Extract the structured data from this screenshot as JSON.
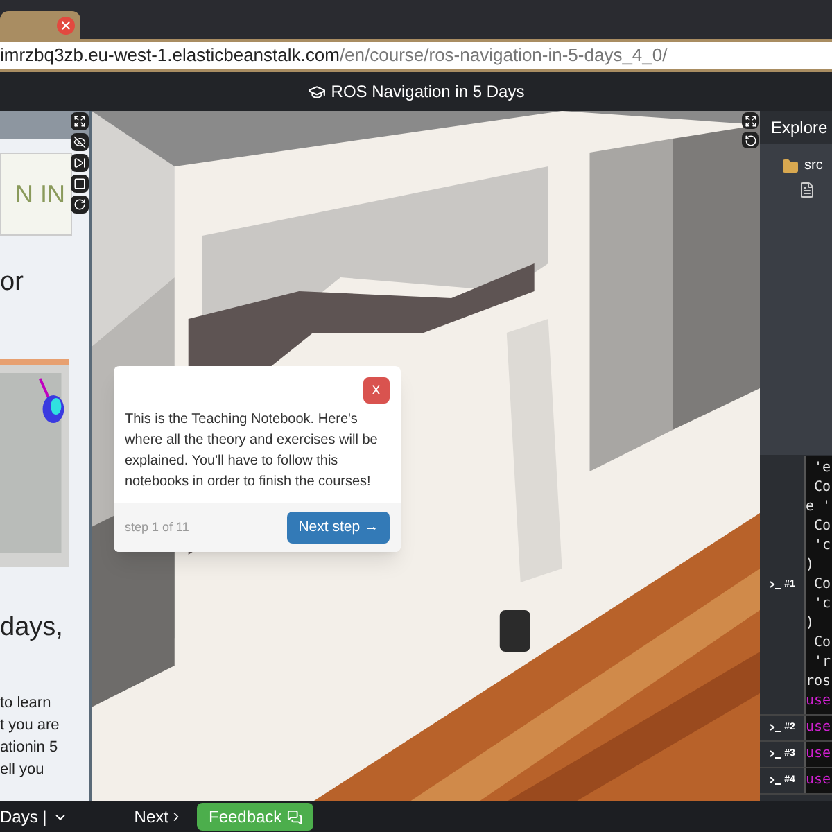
{
  "browser": {
    "url_host": "imrzbq3zb.eu-west-1.elasticbeanstalk.com",
    "url_path": "/en/course/ros-navigation-in-5-days_4_0/"
  },
  "header": {
    "title": "ROS Navigation in 5 Days"
  },
  "notebook": {
    "heading": "N IN",
    "line": "or",
    "subheading": "days,",
    "paragraph_lines": [
      "to learn",
      "t you are",
      "ationin 5",
      "ell you"
    ]
  },
  "tour": {
    "close": "x",
    "text": "This is the Teaching Notebook. Here's where all the theory and exercises will be explained. You'll have to follow this notebooks in order to finish the courses!",
    "step": "step 1 of 11",
    "next": "Next step →"
  },
  "explorer": {
    "title": "Explore",
    "items": [
      {
        "kind": "folder",
        "name": "src"
      },
      {
        "kind": "file"
      }
    ]
  },
  "terminals": [
    {
      "label": "#1",
      "lines": [
        {
          "kind": "output",
          "text": " 'e"
        },
        {
          "kind": "output",
          "text": " Co"
        },
        {
          "kind": "output",
          "text": "e '"
        },
        {
          "kind": "output",
          "text": " Co"
        },
        {
          "kind": "output",
          "text": " 'c"
        },
        {
          "kind": "output",
          "text": ")"
        },
        {
          "kind": "output",
          "text": " Co"
        },
        {
          "kind": "output",
          "text": " 'c"
        },
        {
          "kind": "output",
          "text": ")"
        },
        {
          "kind": "output",
          "text": " Co"
        },
        {
          "kind": "output",
          "text": " 'r"
        },
        {
          "kind": "output",
          "text": "ros"
        },
        {
          "kind": "prompt",
          "text": "use"
        }
      ]
    },
    {
      "label": "#2",
      "lines": [
        {
          "kind": "prompt",
          "text": "use"
        }
      ]
    },
    {
      "label": "#3",
      "lines": [
        {
          "kind": "prompt",
          "text": "use"
        }
      ]
    },
    {
      "label": "#4",
      "lines": [
        {
          "kind": "prompt",
          "text": "use"
        }
      ]
    }
  ],
  "footer": {
    "course": "Days |",
    "next": "Next",
    "feedback": "Feedback"
  }
}
